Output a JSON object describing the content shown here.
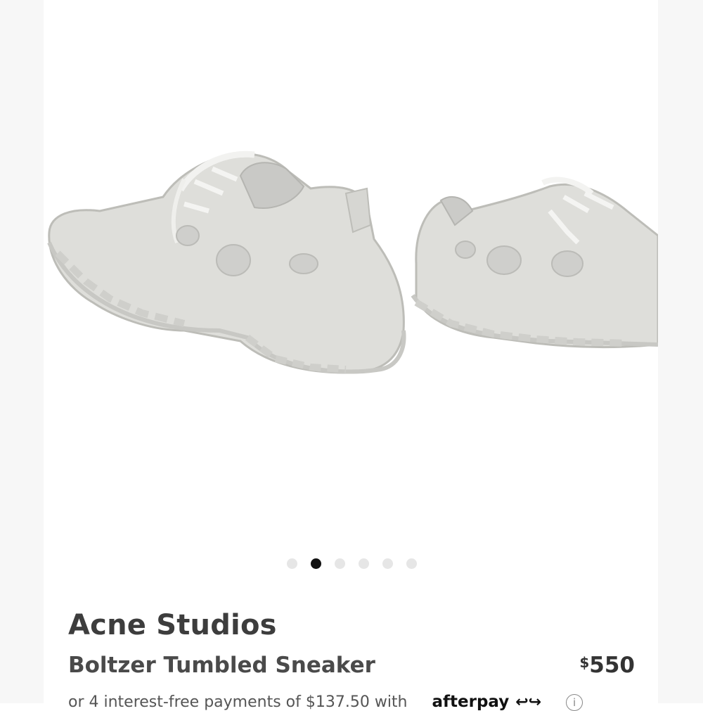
{
  "gallery": {
    "image_alt": "Acne Studios Boltzer Tumbled Sneaker",
    "slide_count": 6,
    "active_slide": 2
  },
  "product": {
    "brand": "Acne Studios",
    "name": "Boltzer Tumbled Sneaker",
    "price_currency": "$",
    "price_amount": "550"
  },
  "afterpay": {
    "text": "or 4 interest-free payments of $137.50 with",
    "logo": "afterpay",
    "logo_mark": "↩↪",
    "info_icon": "i"
  },
  "colors": {
    "active_dot": "#111111",
    "inactive_dot": "#e6e6e6",
    "sneaker": "#dcdcd8"
  }
}
